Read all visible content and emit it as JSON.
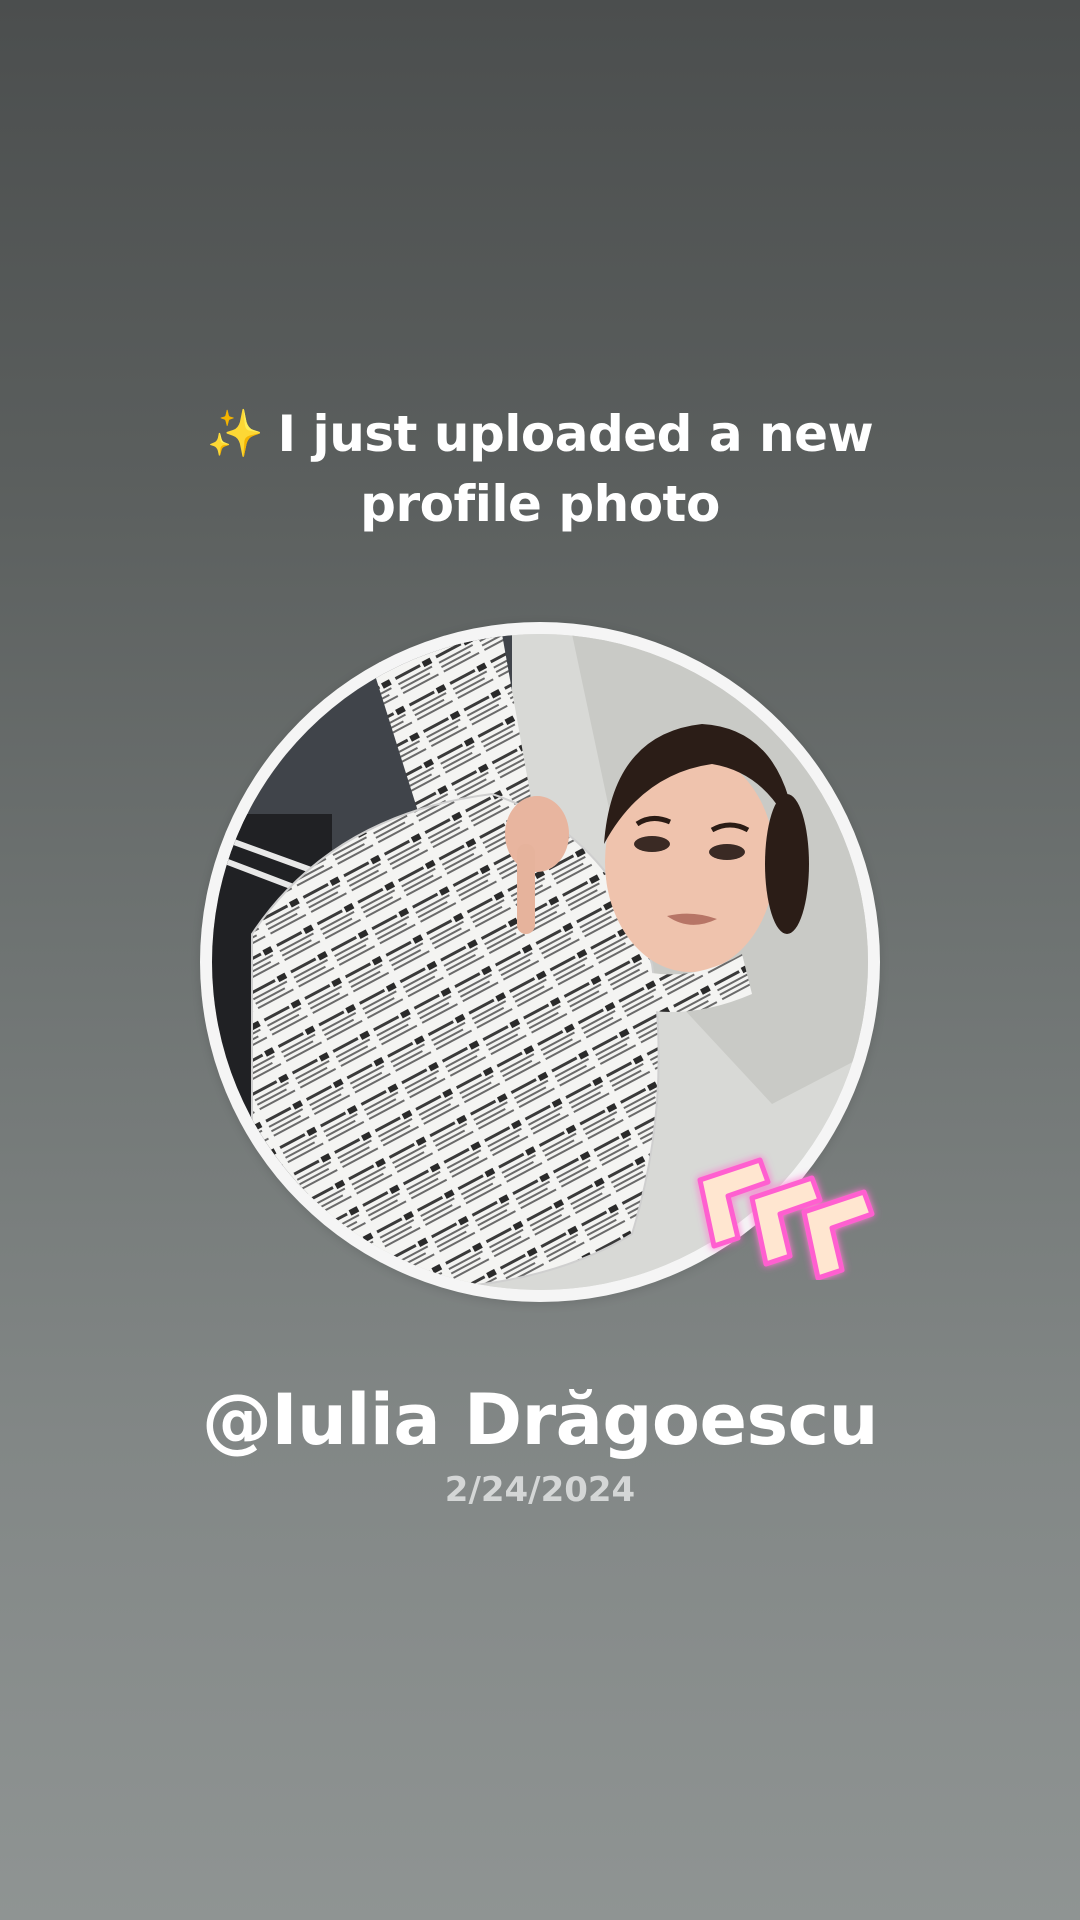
{
  "story": {
    "sparkle_icon": "✨",
    "headline_text": "I just uploaded a new profile photo",
    "username": "@Iulia Drăgoescu",
    "date": "2/24/2024"
  },
  "icons": {
    "sparkle": "sparkle-icon",
    "badge": "neon-chevron-badge-icon"
  },
  "colors": {
    "background_top": "#4b4e4e",
    "background_bottom": "#8f9493",
    "text_primary": "#ffffff",
    "text_secondary": "#d4d6d6",
    "avatar_ring": "#f5f5f5",
    "badge_glow": "#ff5fd0"
  }
}
